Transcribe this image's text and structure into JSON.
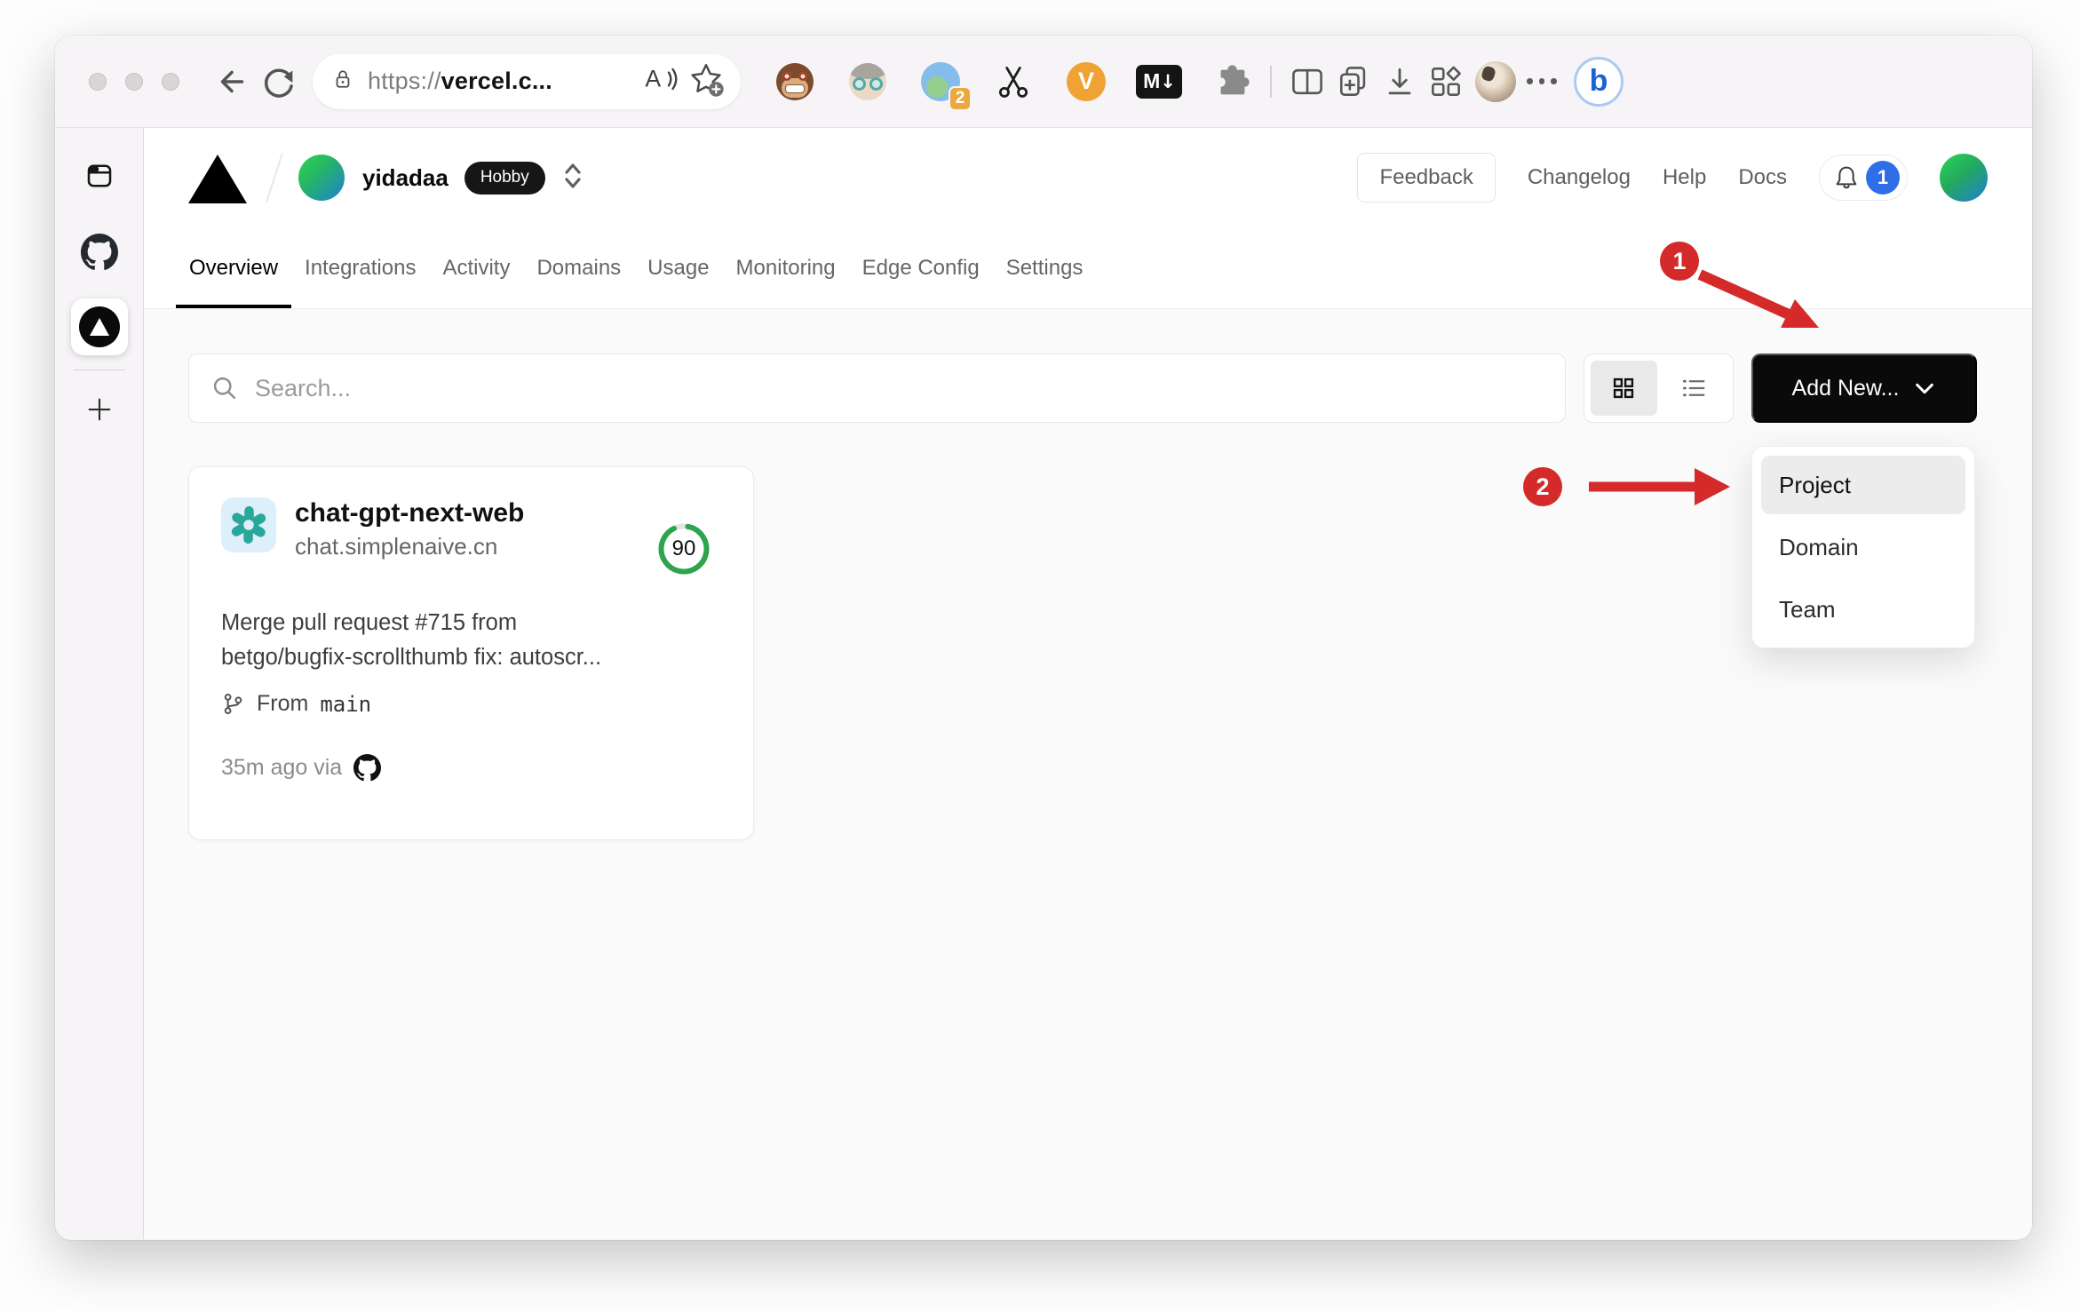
{
  "browser": {
    "url": {
      "scheme": "https://",
      "host": "vercel.c..."
    },
    "extensions": {
      "translate_badge": "2",
      "v_label": "V",
      "markdown_label": "M",
      "markdown_arrow": "↓"
    },
    "bing_label": "b"
  },
  "vercel": {
    "team": "yidadaa",
    "plan": "Hobby",
    "nav": {
      "feedback": "Feedback",
      "links": [
        "Changelog",
        "Help",
        "Docs"
      ],
      "notification_count": "1"
    },
    "tabs": [
      "Overview",
      "Integrations",
      "Activity",
      "Domains",
      "Usage",
      "Monitoring",
      "Edge Config",
      "Settings"
    ],
    "toolbar": {
      "search_placeholder": "Search...",
      "add_new": "Add New..."
    },
    "dropdown": {
      "items": [
        "Project",
        "Domain",
        "Team"
      ]
    },
    "card": {
      "title": "chat-gpt-next-web",
      "domain": "chat.simplenaive.cn",
      "score": "90",
      "commit_line1": "Merge pull request #715 from",
      "commit_line2": "betgo/bugfix-scrollthumb fix: autoscr...",
      "branch_label": "From",
      "branch": "main",
      "meta": "35m ago via"
    }
  },
  "annotations": {
    "step1": "1",
    "step2": "2"
  },
  "colors": {
    "annotation_red": "#d42a2a",
    "score_green": "#2da44e",
    "notification_blue": "#2e6fe8",
    "button_black": "#0a0a0a",
    "content_bg": "#fafafa"
  }
}
